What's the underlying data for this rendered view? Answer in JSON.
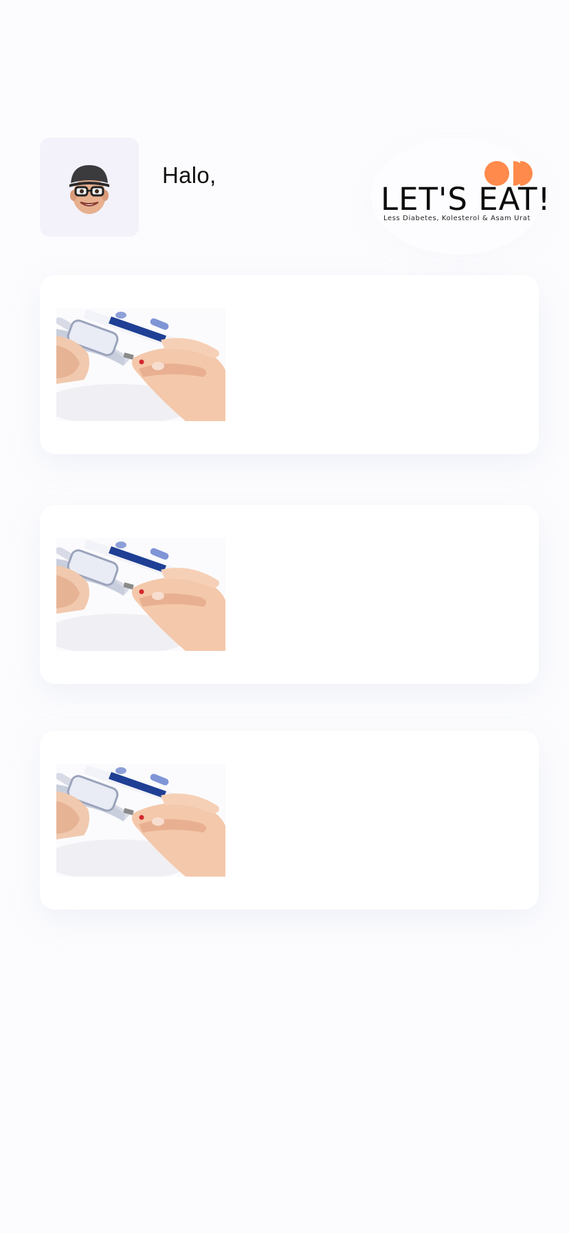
{
  "header": {
    "greeting": "Halo,",
    "avatar_icon": "memoji-avatar-icon",
    "logo": {
      "title": "LET'S EAT!",
      "subtitle": "Less Diabetes, Kolesterol & Asam Urat",
      "mark_icon": "orange-dots-logo-mark",
      "accent_color": "#ff8a4c"
    }
  },
  "cards": [
    {
      "image_icon": "glucose-meter-finger-test-image"
    },
    {
      "image_icon": "glucose-meter-finger-test-image"
    },
    {
      "image_icon": "glucose-meter-finger-test-image"
    }
  ],
  "colors": {
    "background": "#fcfcfe",
    "card": "#ffffff",
    "avatar_bg": "#f3f2fb",
    "text": "#111111"
  }
}
